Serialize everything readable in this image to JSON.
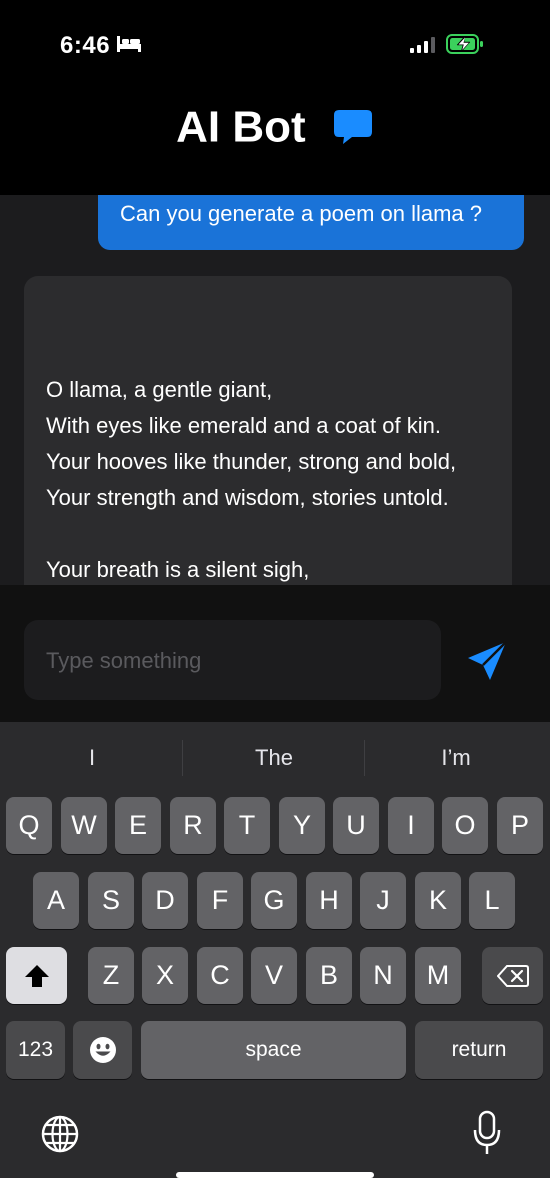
{
  "status_bar": {
    "time": "6:46",
    "icons": [
      "bed-icon",
      "signal-icon",
      "battery-charging-icon"
    ]
  },
  "header": {
    "title": "AI Bot",
    "icon": "chat-bubble-icon",
    "icon_color": "#1a8cff"
  },
  "chat": {
    "user_message": "Can you generate a poem on llama ?",
    "bot_message_lines": [
      "O llama, a gentle giant,",
      "With eyes like emerald and a coat of kin.",
      "Your hooves like thunder, strong and bold,",
      "Your strength and wisdom, stories untold.",
      "",
      "Your breath is a silent sigh,"
    ]
  },
  "composer": {
    "placeholder": "Type something",
    "send_icon": "send-icon",
    "send_color": "#1a8cff"
  },
  "keyboard": {
    "suggestions": [
      "I",
      "The",
      "I’m"
    ],
    "row1": [
      "Q",
      "W",
      "E",
      "R",
      "T",
      "Y",
      "U",
      "I",
      "O",
      "P"
    ],
    "row2": [
      "A",
      "S",
      "D",
      "F",
      "G",
      "H",
      "J",
      "K",
      "L"
    ],
    "row3": [
      "Z",
      "X",
      "C",
      "V",
      "B",
      "N",
      "M"
    ],
    "numbers_label": "123",
    "space_label": "space",
    "return_label": "return",
    "icons": [
      "shift-icon",
      "backspace-icon",
      "emoji-icon",
      "globe-icon",
      "mic-icon"
    ]
  },
  "colors": {
    "user_bubble": "#1a73d8",
    "bot_bubble": "#2c2c2e",
    "background": "#000000"
  }
}
